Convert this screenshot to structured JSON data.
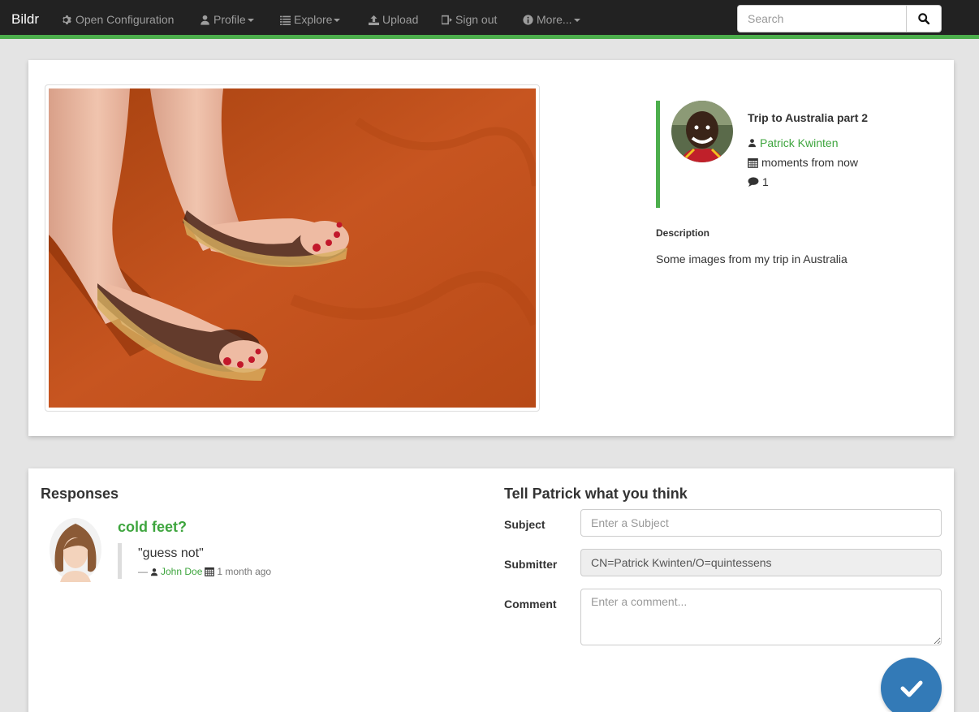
{
  "navbar": {
    "brand": "Bildr",
    "items": [
      {
        "label": "Open Configuration",
        "icon": "gear-icon"
      },
      {
        "label": "Profile",
        "icon": "user-icon",
        "dropdown": true
      },
      {
        "label": "Explore",
        "icon": "list-icon",
        "dropdown": true
      },
      {
        "label": "Upload",
        "icon": "upload-icon"
      },
      {
        "label": "Sign out",
        "icon": "sign-out-icon"
      },
      {
        "label": "More...",
        "icon": "info-icon",
        "dropdown": true
      }
    ],
    "search": {
      "placeholder": "Search"
    }
  },
  "photo_card": {
    "title": "Trip to Australia part 2",
    "author": "Patrick Kwinten",
    "date": "moments from now",
    "comment_count": "1",
    "description_label": "Description",
    "description": "Some images from my trip in Australia"
  },
  "responses": {
    "heading": "Responses",
    "items": [
      {
        "title": "cold feet?",
        "text": "\"guess not\"",
        "dash": "—",
        "author": "John Doe",
        "time": "1 month ago"
      }
    ]
  },
  "form": {
    "heading": "Tell Patrick what you think",
    "subject_label": "Subject",
    "subject_placeholder": "Enter a Subject",
    "submitter_label": "Submitter",
    "submitter_value": "CN=Patrick Kwinten/O=quintessens",
    "comment_label": "Comment",
    "comment_placeholder": "Enter a comment..."
  },
  "colors": {
    "accent": "#4cae4c",
    "link": "#3ea53e",
    "button": "#337ab7",
    "navbar": "#222222"
  }
}
